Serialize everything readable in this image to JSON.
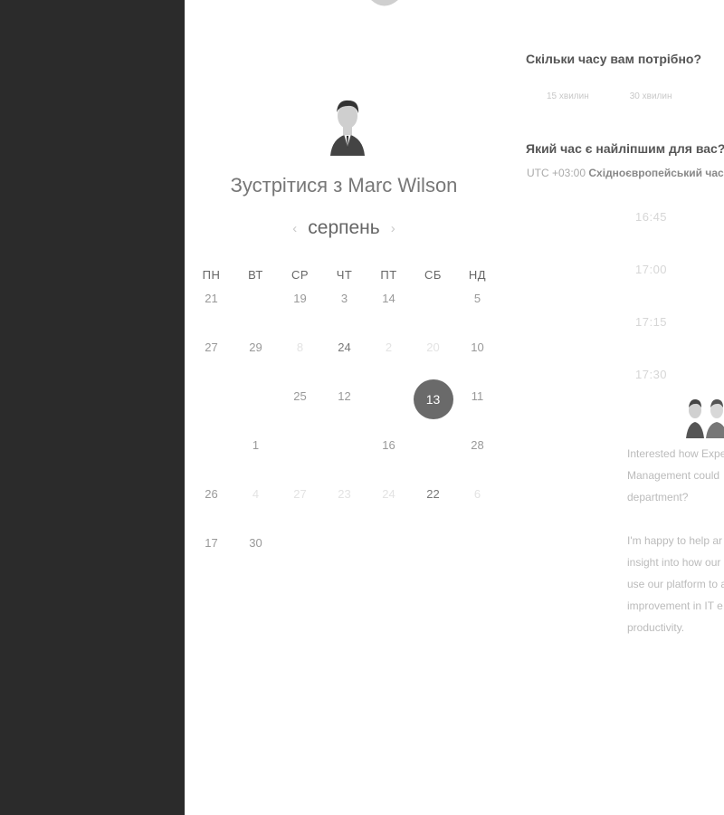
{
  "meeting": {
    "title": "Зустрітися з Marc Wilson"
  },
  "calendar": {
    "month": "серпень",
    "prev_icon": "chevron-left-icon",
    "next_icon": "chevron-right-icon",
    "weekdays": [
      "ПН",
      "ВТ",
      "СР",
      "ЧТ",
      "ПТ",
      "СБ",
      "НД"
    ],
    "weeks": [
      [
        {
          "d": "21",
          "s": "normal"
        },
        {
          "d": "",
          "s": "normal"
        },
        {
          "d": "19",
          "s": "normal"
        },
        {
          "d": "3",
          "s": "normal"
        },
        {
          "d": "14",
          "s": "normal"
        },
        {
          "d": "",
          "s": "normal"
        },
        {
          "d": "5",
          "s": "normal"
        }
      ],
      [
        {
          "d": "27",
          "s": "normal"
        },
        {
          "d": "29",
          "s": "normal"
        },
        {
          "d": "8",
          "s": "faint"
        },
        {
          "d": "24",
          "s": "dark"
        },
        {
          "d": "2",
          "s": "faint"
        },
        {
          "d": "20",
          "s": "faint"
        },
        {
          "d": "10",
          "s": "normal"
        }
      ],
      [
        {
          "d": "",
          "s": "normal"
        },
        {
          "d": "",
          "s": "normal"
        },
        {
          "d": "25",
          "s": "normal"
        },
        {
          "d": "12",
          "s": "normal"
        },
        {
          "d": "",
          "s": "normal"
        },
        {
          "d": "13",
          "s": "selected"
        },
        {
          "d": "11",
          "s": "normal"
        }
      ],
      [
        {
          "d": "",
          "s": "normal"
        },
        {
          "d": "1",
          "s": "normal"
        },
        {
          "d": "",
          "s": "normal"
        },
        {
          "d": "",
          "s": "normal"
        },
        {
          "d": "16",
          "s": "normal"
        },
        {
          "d": "",
          "s": "normal"
        },
        {
          "d": "28",
          "s": "normal"
        }
      ],
      [
        {
          "d": "26",
          "s": "normal"
        },
        {
          "d": "4",
          "s": "faint"
        },
        {
          "d": "27",
          "s": "faint"
        },
        {
          "d": "23",
          "s": "faint"
        },
        {
          "d": "24",
          "s": "faint"
        },
        {
          "d": "22",
          "s": "dark"
        },
        {
          "d": "6",
          "s": "faint"
        }
      ],
      [
        {
          "d": "17",
          "s": "normal"
        },
        {
          "d": "30",
          "s": "normal"
        },
        {
          "d": "",
          "s": "normal"
        },
        {
          "d": "",
          "s": "normal"
        },
        {
          "d": "",
          "s": "normal"
        },
        {
          "d": "",
          "s": "normal"
        },
        {
          "d": "",
          "s": "normal"
        }
      ]
    ]
  },
  "duration": {
    "question": "Скільки часу вам потрібно?",
    "options": [
      "15 хвилин",
      "30 хвилин"
    ]
  },
  "time": {
    "question": "Який час є найліпшим для вас?",
    "tz_offset": "UTC +03:00",
    "tz_name": "Східноєвропейський час",
    "slots": [
      "16:45",
      "17:00",
      "17:15",
      "17:30"
    ]
  },
  "description": {
    "paragraph1": "Interested how Expe\nManagement could\ndepartment?",
    "paragraph2": "I'm happy to help ar\ninsight into how our\nuse our platform to a\nimprovement in IT e\nproductivity."
  },
  "colors": {
    "sidebar": "#2b2b2b",
    "selected_day": "#6a6a6a"
  }
}
